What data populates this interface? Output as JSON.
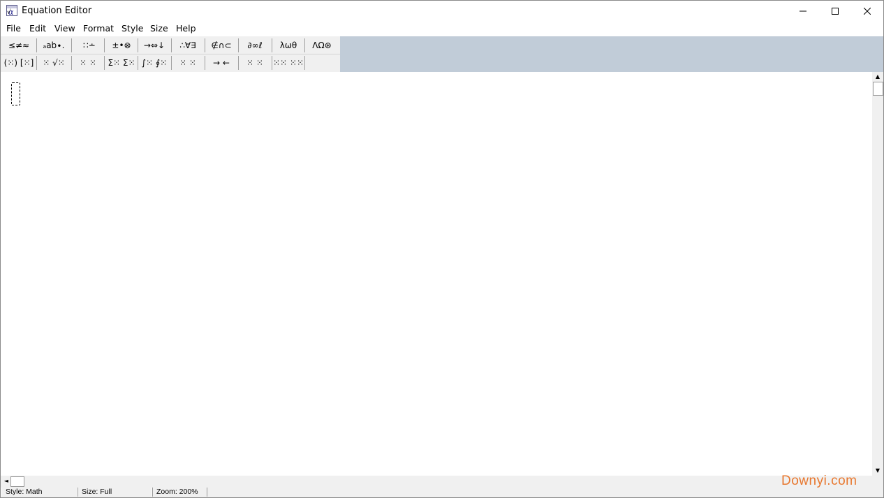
{
  "window": {
    "title": "Equation Editor",
    "controls": {
      "minimize": "—",
      "maximize": "☐",
      "close": "✕"
    }
  },
  "menu": [
    "File",
    "Edit",
    "View",
    "Format",
    "Style",
    "Size",
    "Help"
  ],
  "palette_row1": [
    "≤≠≈",
    "ₐab∙.",
    " ∷∸",
    "±•⊗",
    "→⇔↓",
    "∴∀∃",
    "∉∩⊂",
    "∂∞ℓ",
    "λωθ",
    "ΛΩ⊛"
  ],
  "palette_row2": [
    "(⁙) [⁙]",
    "⁙ √⁙",
    "⁙ ⁙",
    "Σ⁙ Σ⁙",
    "∫⁙ ∮⁙",
    "⁙ ⁙",
    "→ ←",
    "⁙ ⁙",
    "⁙⁙ ⁙⁙",
    ""
  ],
  "status": {
    "style": "Style: Math",
    "size": "Size: Full",
    "zoom": "Zoom: 200%"
  },
  "scroll": {
    "up": "▲",
    "down": "▼",
    "left": "◄",
    "right": "►"
  },
  "watermark": {
    "text": "Downyi.com",
    "color": "#e8772e"
  },
  "colors": {
    "toolbar_bg": "#c1ccd8",
    "palette_bg": "#f0f0f0"
  }
}
